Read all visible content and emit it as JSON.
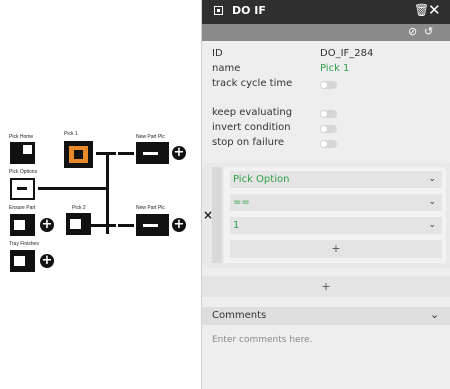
{
  "canvas": {
    "nodes": {
      "pick_home": "Pick Home",
      "pick_options": "Pick Options",
      "ensure_part": "Ensure Part",
      "tray_finishes": "Tray Finishes",
      "pick_1": "Pick 1",
      "pick_2": "Pick 2",
      "new_part_plc_1": "New Part Plc",
      "new_part_plc_2": "New Part Plc"
    },
    "accent_color": "#e8892a"
  },
  "panel": {
    "title": "DO IF",
    "id_label": "ID",
    "id_value": "DO_IF_284",
    "name_label": "name",
    "name_value": "Pick 1",
    "track_label": "track cycle time",
    "keep_label": "keep evaluating",
    "invert_label": "invert condition",
    "stop_label": "stop on failure",
    "condition": {
      "field": "Pick Option",
      "operator": "==",
      "value": "1",
      "add_inner": "+",
      "remove": "×"
    },
    "add_outer": "+",
    "comments_label": "Comments",
    "comments_placeholder": "Enter comments here.",
    "green_color": "#2ea24a"
  }
}
